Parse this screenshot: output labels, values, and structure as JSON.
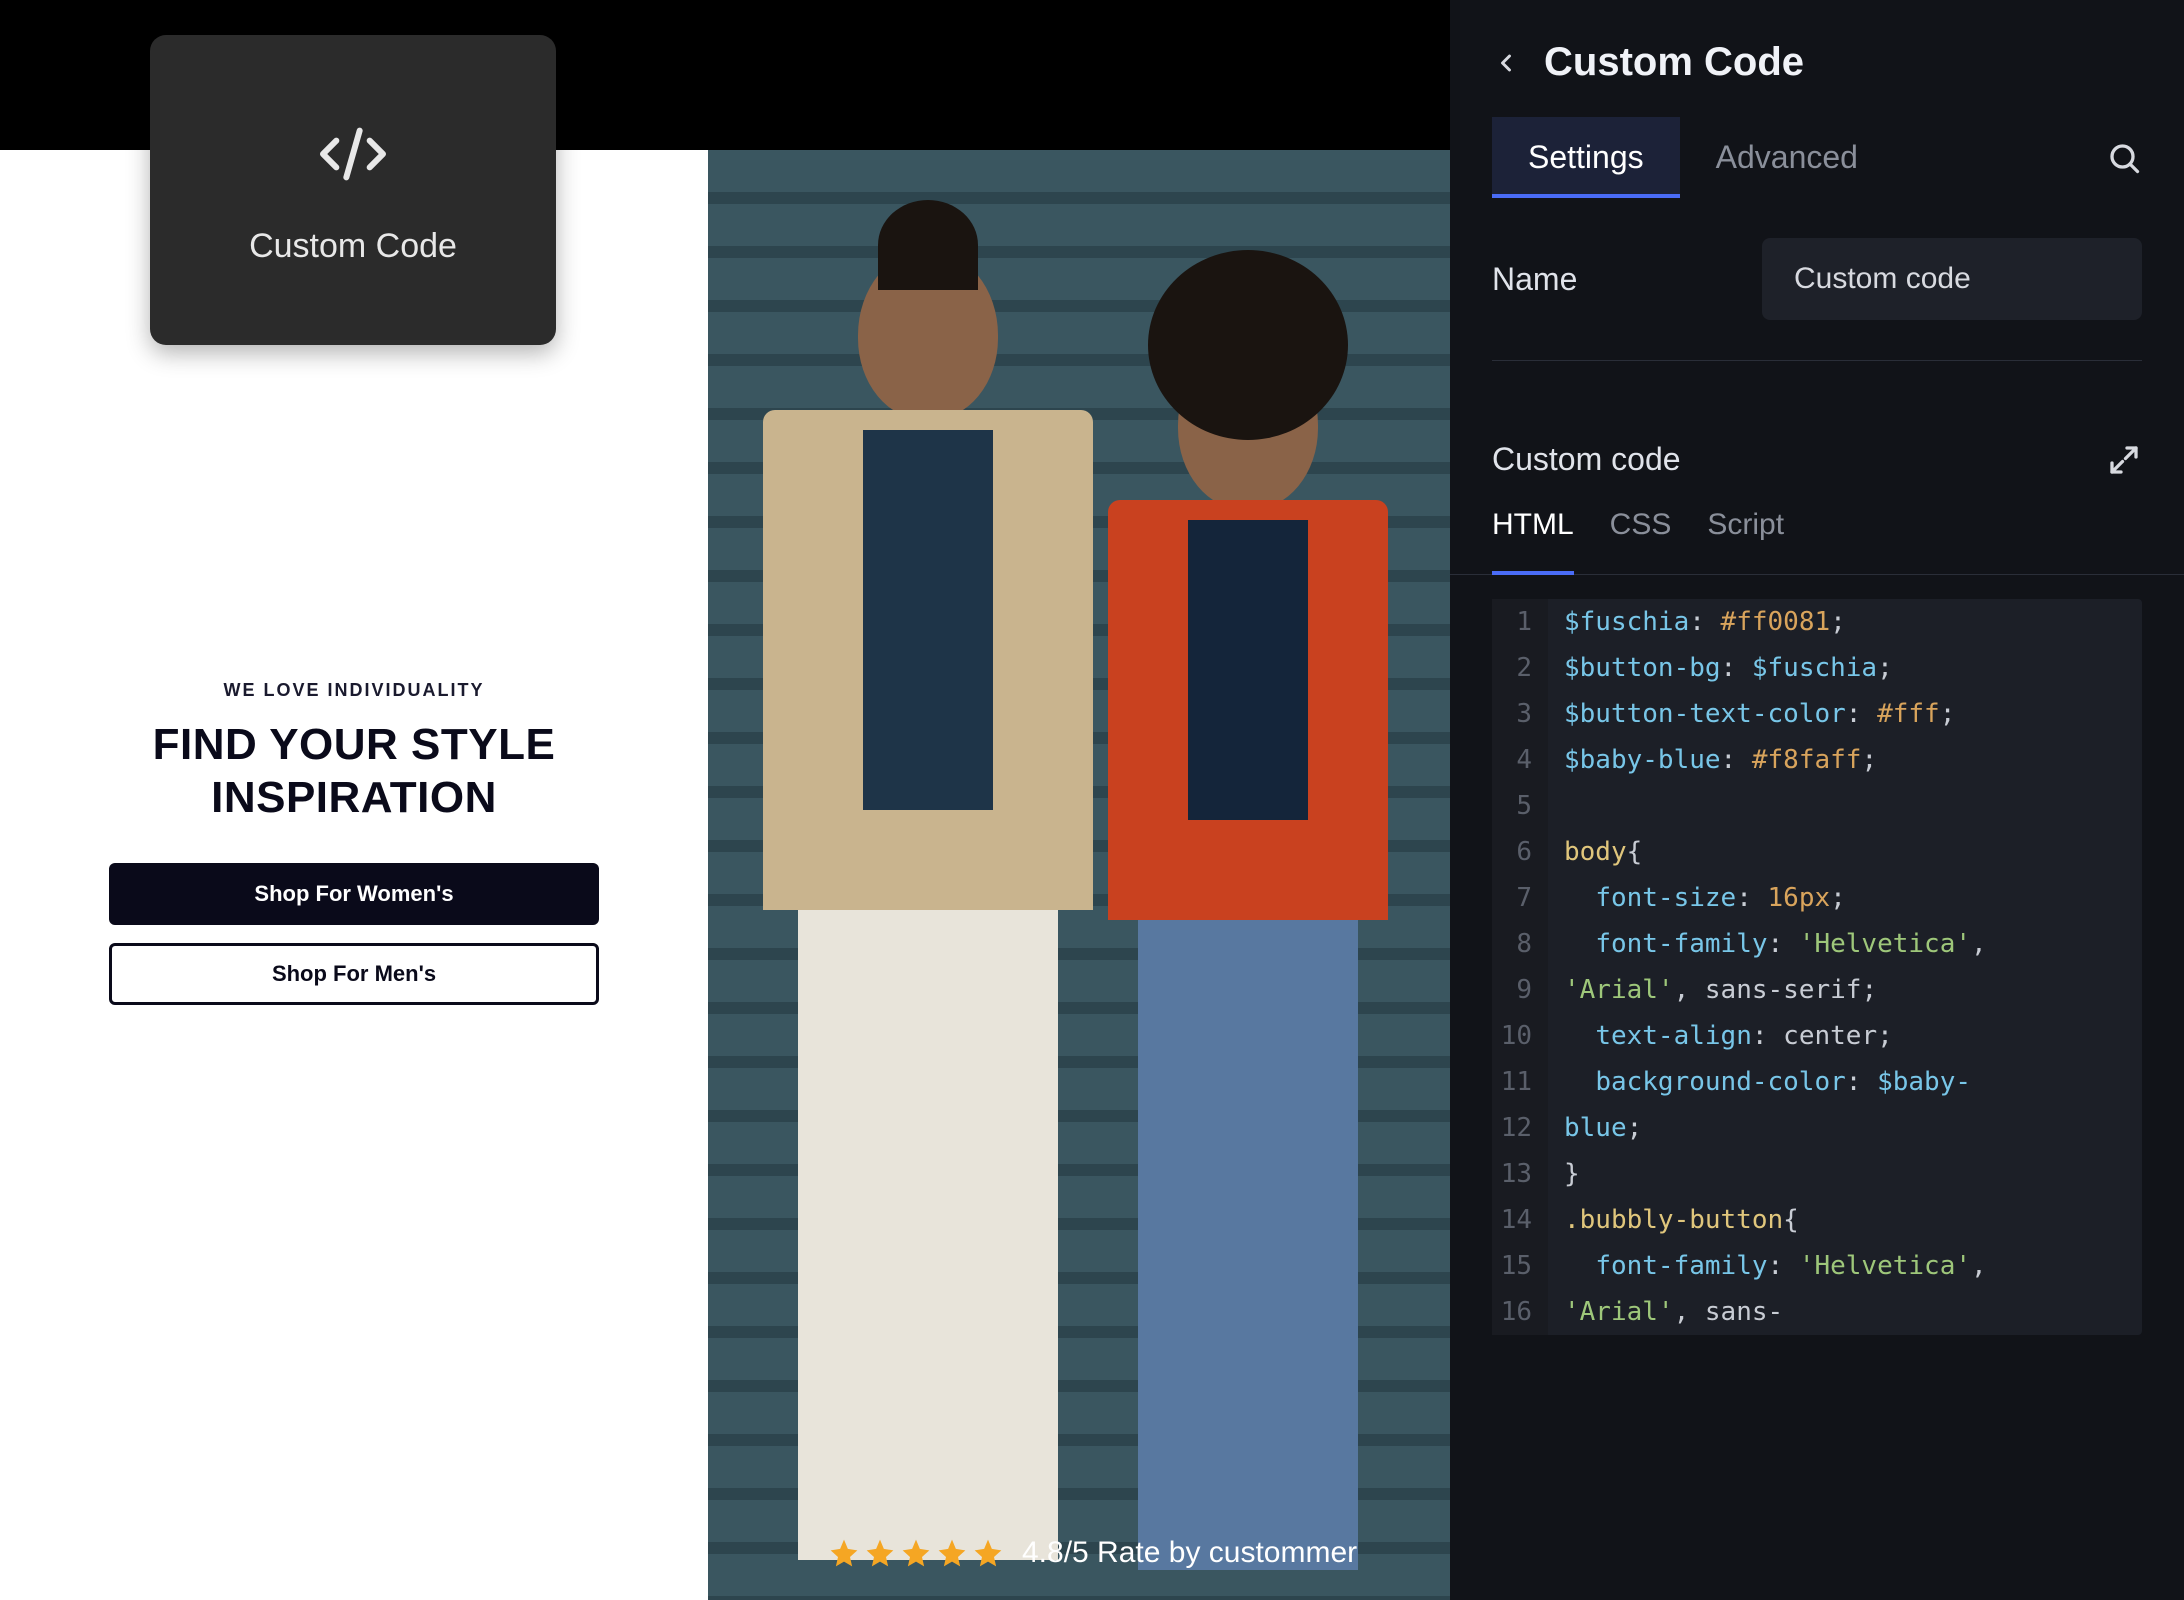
{
  "badge": {
    "label": "Custom Code"
  },
  "hero": {
    "tagline": "WE LOVE INDIVIDUALITY",
    "headline": "FIND YOUR STYLE INSPIRATION",
    "primary_button": "Shop For Women's",
    "secondary_button": "Shop For Men's"
  },
  "rating": {
    "stars": 5,
    "text": "4.8/5 Rate by custommer"
  },
  "panel": {
    "title": "Custom Code",
    "tabs": {
      "settings": "Settings",
      "advanced": "Advanced"
    },
    "name_label": "Name",
    "name_value": "Custom code",
    "code_section_title": "Custom code",
    "code_tabs": {
      "html": "HTML",
      "css": "CSS",
      "script": "Script"
    }
  },
  "code": {
    "lines": [
      {
        "n": 1,
        "tokens": [
          [
            "var",
            "$fuschia"
          ],
          [
            "punct",
            ": "
          ],
          [
            "hex",
            "#ff0081"
          ],
          [
            "punct",
            ";"
          ]
        ]
      },
      {
        "n": 2,
        "tokens": [
          [
            "var",
            "$button-bg"
          ],
          [
            "punct",
            ": "
          ],
          [
            "var",
            "$fuschia"
          ],
          [
            "punct",
            ";"
          ]
        ]
      },
      {
        "n": 3,
        "tokens": [
          [
            "var",
            "$button-text-color"
          ],
          [
            "punct",
            ": "
          ],
          [
            "hex",
            "#fff"
          ],
          [
            "punct",
            ";"
          ]
        ]
      },
      {
        "n": 4,
        "tokens": [
          [
            "var",
            "$baby-blue"
          ],
          [
            "punct",
            ": "
          ],
          [
            "hex",
            "#f8faff"
          ],
          [
            "punct",
            ";"
          ]
        ]
      },
      {
        "n": 5,
        "tokens": []
      },
      {
        "n": 6,
        "tokens": [
          [
            "sel",
            "body"
          ],
          [
            "punct",
            "{"
          ]
        ]
      },
      {
        "n": 7,
        "tokens": [
          [
            "punct",
            "  "
          ],
          [
            "prop",
            "font-size"
          ],
          [
            "punct",
            ": "
          ],
          [
            "num",
            "16px"
          ],
          [
            "punct",
            ";"
          ]
        ]
      },
      {
        "n": 8,
        "tokens": [
          [
            "punct",
            "  "
          ],
          [
            "prop",
            "font-family"
          ],
          [
            "punct",
            ": "
          ],
          [
            "str",
            "'Helvetica'"
          ],
          [
            "punct",
            ","
          ]
        ]
      },
      {
        "n": 9,
        "tokens": [
          [
            "str",
            "'Arial'"
          ],
          [
            "punct",
            ", "
          ],
          [
            "ident",
            "sans-serif"
          ],
          [
            "punct",
            ";"
          ]
        ]
      },
      {
        "n": 10,
        "tokens": [
          [
            "punct",
            "  "
          ],
          [
            "prop",
            "text-align"
          ],
          [
            "punct",
            ": "
          ],
          [
            "ident",
            "center"
          ],
          [
            "punct",
            ";"
          ]
        ]
      },
      {
        "n": 11,
        "tokens": [
          [
            "punct",
            "  "
          ],
          [
            "prop",
            "background-color"
          ],
          [
            "punct",
            ": "
          ],
          [
            "var",
            "$baby-"
          ]
        ]
      },
      {
        "n": 12,
        "tokens": [
          [
            "var",
            "blue"
          ],
          [
            "punct",
            ";"
          ]
        ]
      },
      {
        "n": 13,
        "tokens": [
          [
            "punct",
            "}"
          ]
        ]
      },
      {
        "n": 14,
        "tokens": [
          [
            "sel",
            ".bubbly-button"
          ],
          [
            "punct",
            "{"
          ]
        ]
      },
      {
        "n": 15,
        "tokens": [
          [
            "punct",
            "  "
          ],
          [
            "prop",
            "font-family"
          ],
          [
            "punct",
            ": "
          ],
          [
            "str",
            "'Helvetica'"
          ],
          [
            "punct",
            ","
          ]
        ]
      },
      {
        "n": 16,
        "tokens": [
          [
            "str",
            "'Arial'"
          ],
          [
            "punct",
            ", "
          ],
          [
            "ident",
            "sans-"
          ]
        ]
      }
    ]
  }
}
